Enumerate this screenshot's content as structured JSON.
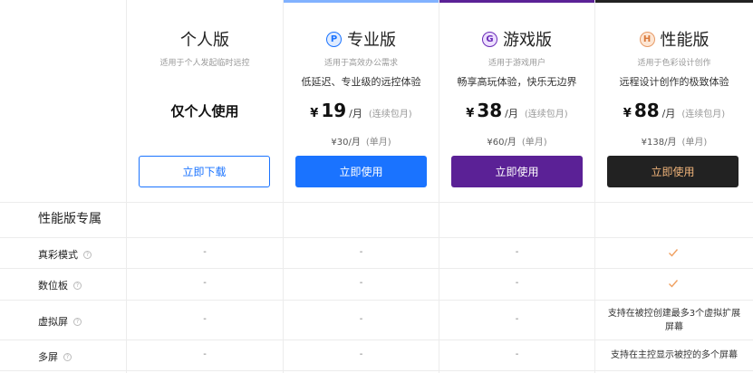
{
  "plans": {
    "personal": {
      "title": "个人版",
      "subtitle": "适用于个人发起临时远控",
      "usage": "仅个人使用",
      "button": "立即下载"
    },
    "pro": {
      "icon_letter": "P",
      "icon_name": "pro-badge-icon",
      "title": "专业版",
      "subtitle": "适用于高效办公需求",
      "description": "低延迟、专业级的远控体验",
      "currency": "¥",
      "price": "19",
      "unit": "/月",
      "note": "(连续包月)",
      "monthly_price": "¥30/月",
      "monthly_note": "(单月)",
      "button": "立即使用",
      "accent": "#1a73ff"
    },
    "game": {
      "icon_letter": "G",
      "icon_name": "game-badge-icon",
      "title": "游戏版",
      "subtitle": "适用于游戏用户",
      "description": "畅享高玩体验，快乐无边界",
      "currency": "¥",
      "price": "38",
      "unit": "/月",
      "note": "(连续包月)",
      "monthly_price": "¥60/月",
      "monthly_note": "(单月)",
      "button": "立即使用",
      "accent": "#5b2196"
    },
    "performance": {
      "icon_letter": "H",
      "icon_name": "performance-badge-icon",
      "title": "性能版",
      "subtitle": "适用于色彩设计创作",
      "description": "远程设计创作的极致体验",
      "currency": "¥",
      "price": "88",
      "unit": "/月",
      "note": "(连续包月)",
      "monthly_price": "¥138/月",
      "monthly_note": "(单月)",
      "button": "立即使用",
      "accent": "#222222",
      "button_text_color": "#f0b47a"
    }
  },
  "section": {
    "title": "性能版专属"
  },
  "features": [
    {
      "name": "真彩模式",
      "personal": "-",
      "pro": "-",
      "game": "-",
      "performance": "check"
    },
    {
      "name": "数位板",
      "personal": "-",
      "pro": "-",
      "game": "-",
      "performance": "check"
    },
    {
      "name": "虚拟屏",
      "personal": "-",
      "pro": "-",
      "game": "-",
      "performance_line1": "支持在被控创建最多3个虚拟扩展",
      "performance_line2": "屏幕"
    },
    {
      "name": "多屏",
      "personal": "-",
      "pro": "-",
      "game": "-",
      "performance": "支持在主控显示被控的多个屏幕"
    }
  ],
  "help_glyph": "?",
  "colors": {
    "check": "#f0a060",
    "border": "#ececec"
  }
}
